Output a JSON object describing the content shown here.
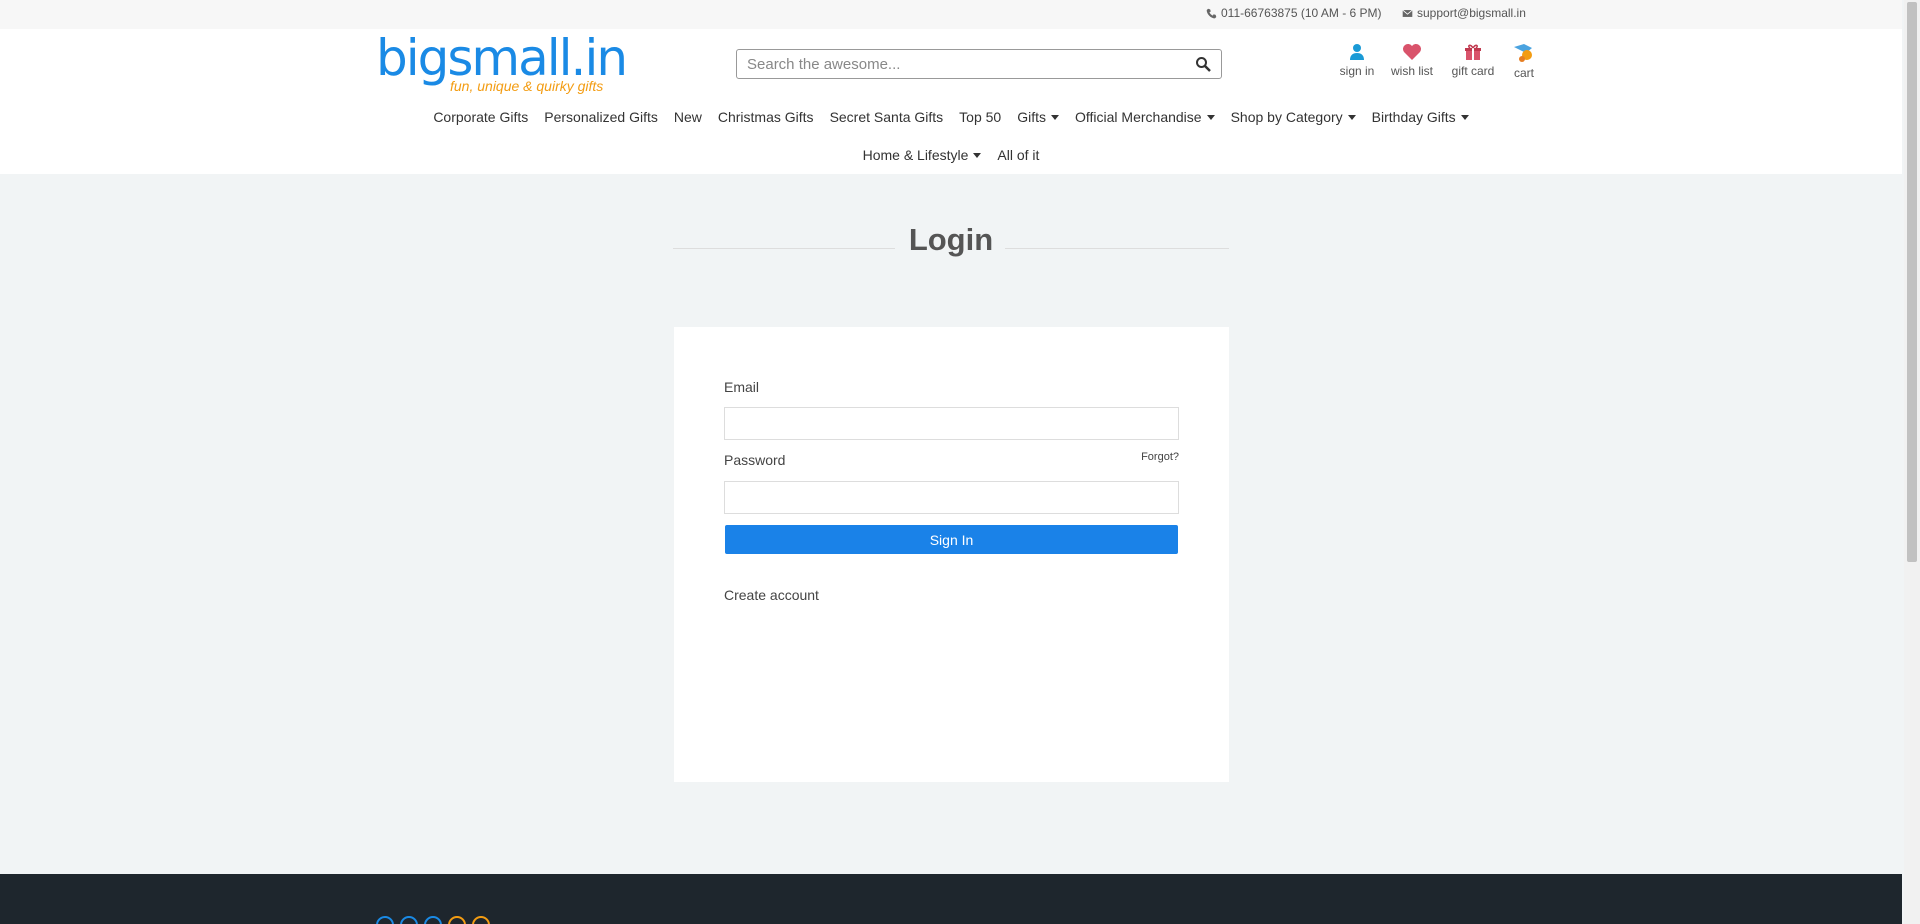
{
  "topbar": {
    "phone": "011-66763875 (10 AM - 6 PM)",
    "email": "support@bigsmall.in"
  },
  "header": {
    "logo_word": "bigsmall.in",
    "logo_tagline": "fun, unique & quirky gifts",
    "search_placeholder": "Search the awesome...",
    "icons": {
      "signin": "sign in",
      "wishlist": "wish list",
      "giftcard": "gift card",
      "cart": "cart"
    }
  },
  "nav": {
    "row1": [
      {
        "label": "Corporate Gifts",
        "dropdown": false
      },
      {
        "label": "Personalized Gifts",
        "dropdown": false
      },
      {
        "label": "New",
        "dropdown": false
      },
      {
        "label": "Christmas Gifts",
        "dropdown": false
      },
      {
        "label": "Secret Santa Gifts",
        "dropdown": false
      },
      {
        "label": "Top 50",
        "dropdown": false
      },
      {
        "label": "Gifts",
        "dropdown": true
      },
      {
        "label": "Official Merchandise",
        "dropdown": true
      },
      {
        "label": "Shop by Category",
        "dropdown": true
      },
      {
        "label": "Birthday Gifts",
        "dropdown": true
      }
    ],
    "row2": [
      {
        "label": "Home & Lifestyle",
        "dropdown": true
      },
      {
        "label": "All of it",
        "dropdown": false
      }
    ]
  },
  "login": {
    "title": "Login",
    "email_label": "Email",
    "email_value": "",
    "password_label": "Password",
    "forgot": "Forgot?",
    "signin_button": "Sign In",
    "create_account": "Create account"
  },
  "colors": {
    "brand_blue": "#1a8ae5",
    "brand_orange": "#f39c12",
    "button_blue": "#1a82e8",
    "footer_bg": "#1e262d"
  }
}
